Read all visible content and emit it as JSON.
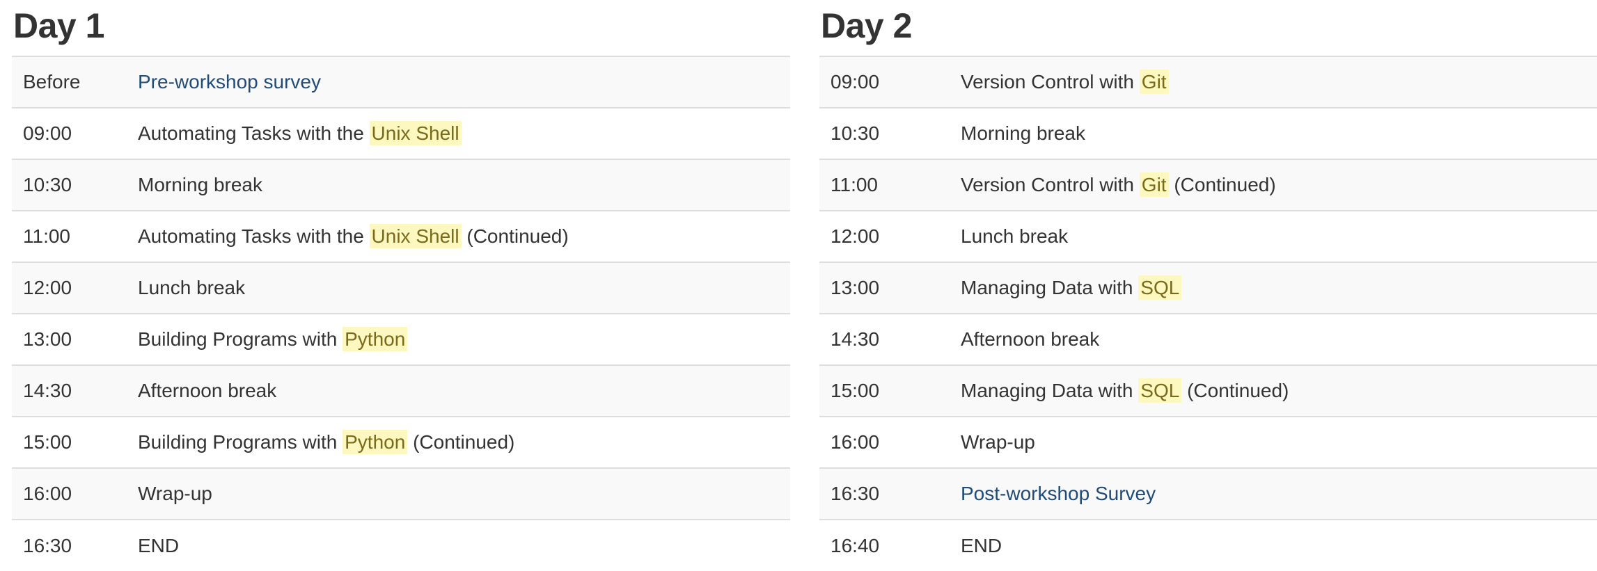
{
  "day1": {
    "title": "Day 1",
    "rows": [
      {
        "time": "Before",
        "pre": "",
        "link": "Pre-workshop survey",
        "highlight": "",
        "post": ""
      },
      {
        "time": "09:00",
        "pre": "Automating Tasks with the ",
        "link": "",
        "highlight": "Unix Shell",
        "post": ""
      },
      {
        "time": "10:30",
        "pre": "Morning break",
        "link": "",
        "highlight": "",
        "post": ""
      },
      {
        "time": "11:00",
        "pre": "Automating Tasks with the ",
        "link": "",
        "highlight": "Unix Shell",
        "post": " (Continued)"
      },
      {
        "time": "12:00",
        "pre": "Lunch break",
        "link": "",
        "highlight": "",
        "post": ""
      },
      {
        "time": "13:00",
        "pre": "Building Programs with ",
        "link": "",
        "highlight": "Python",
        "post": ""
      },
      {
        "time": "14:30",
        "pre": "Afternoon break",
        "link": "",
        "highlight": "",
        "post": ""
      },
      {
        "time": "15:00",
        "pre": "Building Programs with ",
        "link": "",
        "highlight": "Python",
        "post": " (Continued)"
      },
      {
        "time": "16:00",
        "pre": "Wrap-up",
        "link": "",
        "highlight": "",
        "post": ""
      },
      {
        "time": "16:30",
        "pre": "END",
        "link": "",
        "highlight": "",
        "post": ""
      }
    ]
  },
  "day2": {
    "title": "Day 2",
    "rows": [
      {
        "time": "09:00",
        "pre": "Version Control with ",
        "link": "",
        "highlight": "Git",
        "post": ""
      },
      {
        "time": "10:30",
        "pre": "Morning break",
        "link": "",
        "highlight": "",
        "post": ""
      },
      {
        "time": "11:00",
        "pre": "Version Control with ",
        "link": "",
        "highlight": "Git",
        "post": " (Continued)"
      },
      {
        "time": "12:00",
        "pre": "Lunch break",
        "link": "",
        "highlight": "",
        "post": ""
      },
      {
        "time": "13:00",
        "pre": "Managing Data with ",
        "link": "",
        "highlight": "SQL",
        "post": ""
      },
      {
        "time": "14:30",
        "pre": "Afternoon break",
        "link": "",
        "highlight": "",
        "post": ""
      },
      {
        "time": "15:00",
        "pre": "Managing Data with ",
        "link": "",
        "highlight": "SQL",
        "post": " (Continued)"
      },
      {
        "time": "16:00",
        "pre": "Wrap-up",
        "link": "",
        "highlight": "",
        "post": ""
      },
      {
        "time": "16:30",
        "pre": "",
        "link": "Post-workshop Survey",
        "highlight": "",
        "post": ""
      },
      {
        "time": "16:40",
        "pre": "END",
        "link": "",
        "highlight": "",
        "post": ""
      }
    ]
  },
  "colors": {
    "text": "#333333",
    "link": "#1f4b78",
    "highlight_bg": "#fcf8c0",
    "stripe": "#f9f9f9",
    "border": "#dddddd"
  }
}
